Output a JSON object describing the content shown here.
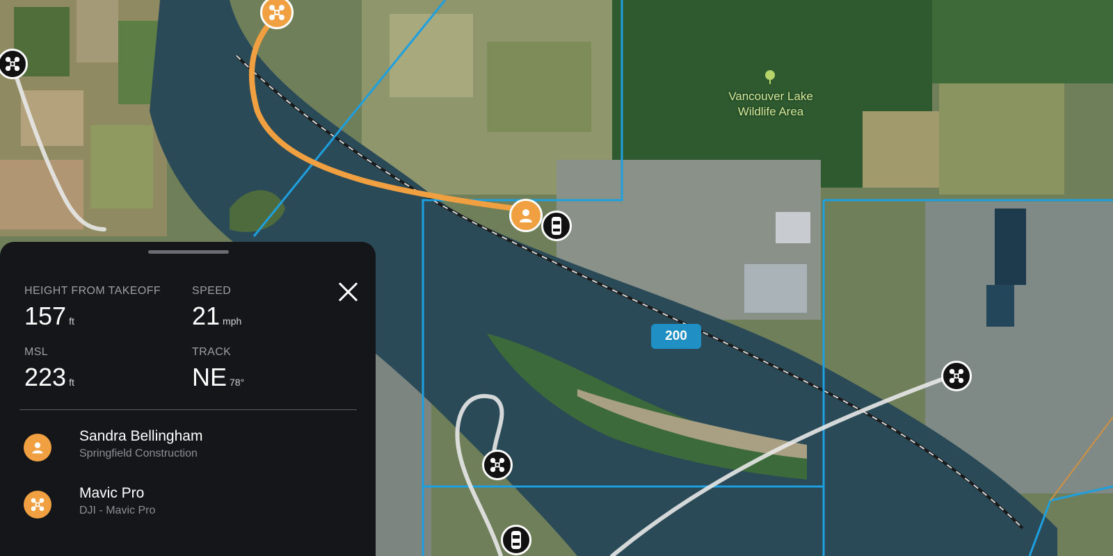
{
  "map": {
    "grid_label": "200",
    "place_name": [
      "Vancouver Lake",
      "Wildlife Area"
    ],
    "icons": {
      "drone": "drone-icon",
      "person": "person-icon",
      "vehicle": "vehicle-icon",
      "park": "tree-icon"
    },
    "colors": {
      "grid": "#1ea0e0",
      "flight_path_selected": "#f0a040",
      "flight_path": "#e8e8e8",
      "water": "#2b4a57"
    }
  },
  "panel": {
    "stats": [
      {
        "label": "HEIGHT FROM TAKEOFF",
        "value": "157",
        "unit": "ft"
      },
      {
        "label": "SPEED",
        "value": "21",
        "unit": "mph"
      },
      {
        "label": "MSL",
        "value": "223",
        "unit": "ft"
      },
      {
        "label": "TRACK",
        "value": "NE",
        "unit": "78°"
      }
    ],
    "pilot": {
      "name": "Sandra Bellingham",
      "org": "Springfield Construction"
    },
    "aircraft": {
      "name": "Mavic Pro",
      "model": "DJI - Mavic Pro"
    }
  }
}
